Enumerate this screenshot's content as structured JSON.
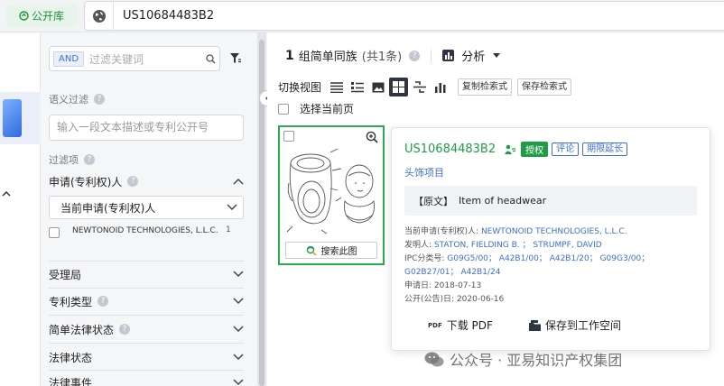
{
  "topbar": {
    "library_label": "公开库",
    "search_value": "US10684483B2"
  },
  "filter": {
    "and_label": "AND",
    "keyword_placeholder": "过滤关键词",
    "semantic_label": "语义过滤",
    "semantic_placeholder": "输入一段文本描述或专利公开号",
    "filter_items_label": "过滤项",
    "applicant_label": "申请(专利权)人",
    "applicant_select": "当前申请(专利权)人",
    "applicant_option": {
      "label": "NEWTONOID TECHNOLOGIES, L.L.C.",
      "count": "1"
    },
    "sections": [
      "受理局",
      "专利类型",
      "简单法律状态",
      "法律状态",
      "法律事件"
    ]
  },
  "results": {
    "count": "1",
    "title": "组简单同族",
    "subtitle": "(共1条)",
    "analysis_label": "分析",
    "switch_view_label": "切换视图",
    "copy_button": "复制检索式",
    "save_button": "保存检索式",
    "select_page_label": "选择当前页",
    "search_figure_label": "搜索此图"
  },
  "detail": {
    "pn": "US10684483B2",
    "status": "授权",
    "tag_review": "评论",
    "tag_extension": "期限延长",
    "title": "头饰项目",
    "orig_label": "【原文】",
    "orig_title": "Item of headwear",
    "applicant_label": "当前申请(专利权)人:",
    "applicant": "NEWTONOID TECHNOLOGIES, L.L.C.",
    "inventor_label": "发明人:",
    "inventors": [
      "STATON, FIELDING B.",
      "STRUMPF, DAVID"
    ],
    "ipc_label": "IPC分类号:",
    "ipc_line1": [
      "G09G5/00",
      "A42B1/00",
      "A42B1/20",
      "G09G3/00"
    ],
    "ipc_line2": [
      "G02B27/01",
      "A42B1/24"
    ],
    "filing_label": "申请日:",
    "filing_date": "2018-07-13",
    "pub_label": "公开(公告)日:",
    "pub_date": "2020-06-16",
    "download_label": "下载 PDF",
    "pdf_badge": "PDF",
    "save_workspace_label": "保存到工作空间"
  },
  "watermark": "公众号 · 亚易知识产权集团",
  "colors": {
    "green": "#1f9d45",
    "blue": "#3d6fd1",
    "dark": "#2f3542"
  }
}
